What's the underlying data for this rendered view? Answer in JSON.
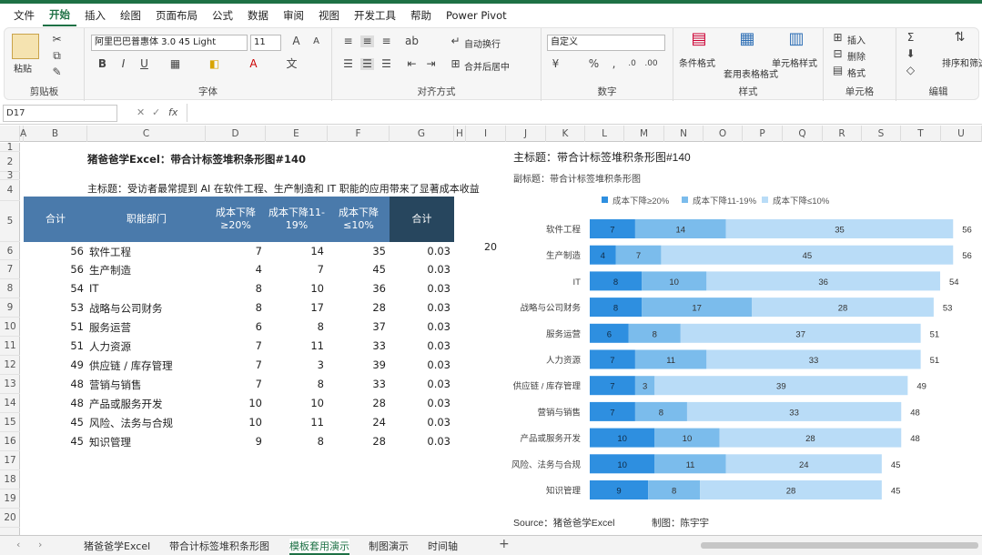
{
  "menu": [
    "文件",
    "开始",
    "插入",
    "绘图",
    "页面布局",
    "公式",
    "数据",
    "审阅",
    "视图",
    "开发工具",
    "帮助",
    "Power Pivot"
  ],
  "ribbon": {
    "clipboard": {
      "paste": "粘贴",
      "label": "剪贴板"
    },
    "font": {
      "name": "阿里巴巴普惠体 3.0 45 Light",
      "size": "11",
      "label": "字体",
      "bold": "B",
      "italic": "I",
      "underline": "U"
    },
    "alignment": {
      "wrap": "自动换行",
      "merge": "合并后居中",
      "label": "对齐方式"
    },
    "number": {
      "format": "自定义",
      "label": "数字"
    },
    "styles": {
      "cond": "条件格式",
      "table": "套用表格格式",
      "cell": "单元格样式",
      "label": "样式"
    },
    "cells": {
      "insert": "插入",
      "delete": "删除",
      "format": "格式",
      "label": "单元格"
    },
    "editing": {
      "sort": "排序和筛选",
      "label": "编辑"
    }
  },
  "formula": {
    "namebox": "D17",
    "fx": "fx",
    "content": ""
  },
  "columns": [
    "A",
    "B",
    "C",
    "D",
    "E",
    "F",
    "G",
    "H",
    "I",
    "J",
    "K",
    "L",
    "M",
    "N",
    "O",
    "P",
    "Q",
    "R",
    "S",
    "T",
    "U"
  ],
  "rows": [
    "1",
    "2",
    "3",
    "4",
    "5",
    "6",
    "7",
    "8",
    "9",
    "10",
    "11",
    "12",
    "13",
    "14",
    "15",
    "16",
    "17",
    "18",
    "19",
    "20"
  ],
  "sheet": {
    "title": "猪爸爸学Excel：带合计标签堆积条形图#140",
    "subtitle": "主标题：受访者最常提到 AI 在软件工程、生产制造和 IT 职能的应用带来了显著成本收益",
    "headers": [
      "合计",
      "职能部门",
      "成本下降≥20%",
      "成本下降11-19%",
      "成本下降≤10%",
      "合计"
    ],
    "rows": [
      {
        "total": "56",
        "dept": "软件工程",
        "a": "7",
        "b": "14",
        "c": "35",
        "g": "0.03"
      },
      {
        "total": "56",
        "dept": "生产制造",
        "a": "4",
        "b": "7",
        "c": "45",
        "g": "0.03"
      },
      {
        "total": "54",
        "dept": "IT",
        "a": "8",
        "b": "10",
        "c": "36",
        "g": "0.03"
      },
      {
        "total": "53",
        "dept": "战略与公司财务",
        "a": "8",
        "b": "17",
        "c": "28",
        "g": "0.03"
      },
      {
        "total": "51",
        "dept": "服务运营",
        "a": "6",
        "b": "8",
        "c": "37",
        "g": "0.03"
      },
      {
        "total": "51",
        "dept": "人力资源",
        "a": "7",
        "b": "11",
        "c": "33",
        "g": "0.03"
      },
      {
        "total": "49",
        "dept": "供应链 / 库存管理",
        "a": "7",
        "b": "3",
        "c": "39",
        "g": "0.03"
      },
      {
        "total": "48",
        "dept": "营销与销售",
        "a": "7",
        "b": "8",
        "c": "33",
        "g": "0.03"
      },
      {
        "total": "48",
        "dept": "产品或服务开发",
        "a": "10",
        "b": "10",
        "c": "28",
        "g": "0.03"
      },
      {
        "total": "45",
        "dept": "风险、法务与合规",
        "a": "10",
        "b": "11",
        "c": "24",
        "g": "0.03"
      },
      {
        "total": "45",
        "dept": "知识管理",
        "a": "9",
        "b": "8",
        "c": "28",
        "g": "0.03"
      }
    ],
    "h6": "20"
  },
  "chart_data": {
    "type": "bar",
    "orientation": "horizontal-stacked",
    "title": "主标题：带合计标签堆积条形图#140",
    "subtitle": "副标题：带合计标签堆积条形图",
    "legend_position": "top",
    "categories": [
      "软件工程",
      "生产制造",
      "IT",
      "战略与公司财务",
      "服务运营",
      "人力资源",
      "供应链 / 库存管理",
      "营销与销售",
      "产品或服务开发",
      "风险、法务与合规",
      "知识管理"
    ],
    "series": [
      {
        "name": "成本下降≥20%",
        "color": "#2e8fe0",
        "values": [
          7,
          4,
          8,
          8,
          6,
          7,
          7,
          7,
          10,
          10,
          9
        ]
      },
      {
        "name": "成本下降11-19%",
        "color": "#7bbcec",
        "values": [
          14,
          7,
          10,
          17,
          8,
          11,
          3,
          8,
          10,
          11,
          8
        ]
      },
      {
        "name": "成本下降≤10%",
        "color": "#b9dcf7",
        "values": [
          35,
          45,
          36,
          28,
          37,
          33,
          39,
          33,
          28,
          24,
          28
        ]
      }
    ],
    "totals": [
      56,
      56,
      54,
      53,
      51,
      51,
      49,
      48,
      48,
      45,
      45
    ],
    "xlim": [
      0,
      56
    ],
    "source": "Source：猪爸爸学Excel",
    "author": "制图：陈宇宇"
  },
  "tabs": [
    "猪爸爸学Excel",
    "带合计标签堆积条形图",
    "模板套用演示",
    "制图演示",
    "时间轴"
  ],
  "colors": {
    "header": "#4a7aab",
    "headerDark": "#27465e",
    "accent": "#1e7145"
  }
}
